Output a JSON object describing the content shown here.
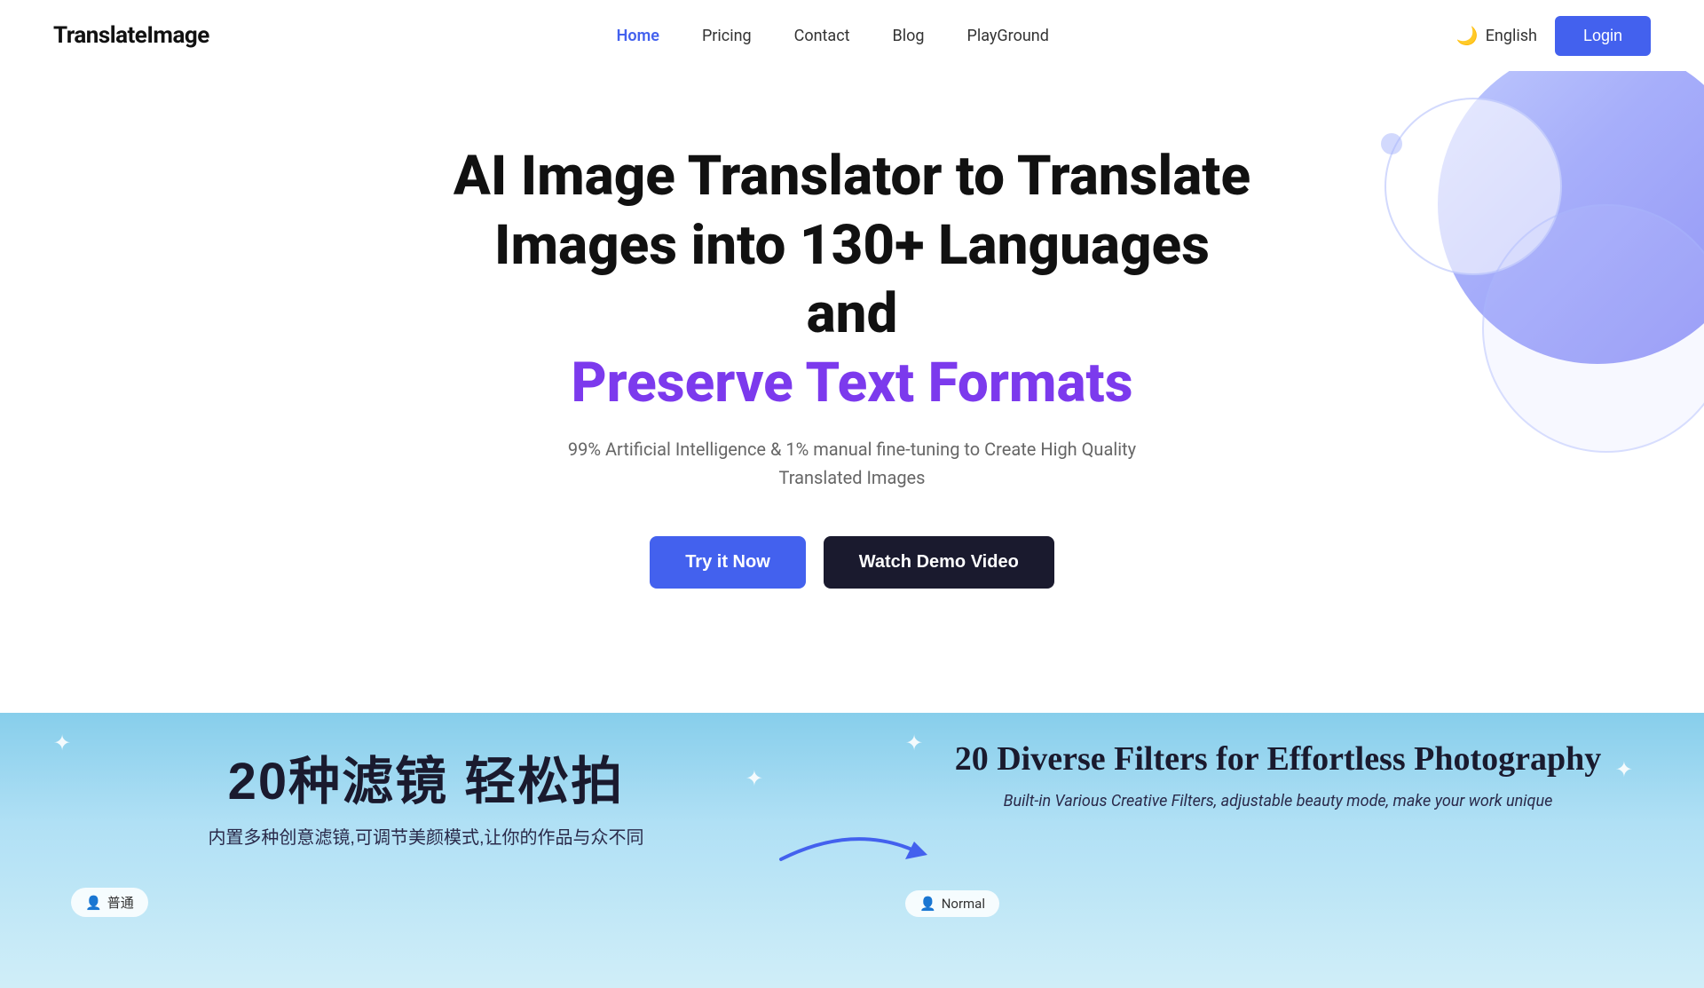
{
  "brand": {
    "name": "TranslateImage"
  },
  "navbar": {
    "links": [
      {
        "label": "Home",
        "active": true,
        "id": "home"
      },
      {
        "label": "Pricing",
        "active": false,
        "id": "pricing"
      },
      {
        "label": "Contact",
        "active": false,
        "id": "contact"
      },
      {
        "label": "Blog",
        "active": false,
        "id": "blog"
      },
      {
        "label": "PlayGround",
        "active": false,
        "id": "playground"
      }
    ],
    "language": "English",
    "login_label": "Login"
  },
  "hero": {
    "title_line1": "AI Image Translator to Translate",
    "title_line2": "Images into 130+ Languages and",
    "title_highlight": "Preserve Text Formats",
    "subtitle": "99% Artificial Intelligence & 1% manual fine-tuning to Create High Quality Translated Images",
    "btn_primary": "Try it Now",
    "btn_secondary": "Watch Demo Video"
  },
  "demo": {
    "before": {
      "main_text": "20种滤镜 轻松拍",
      "sub_text": "内置多种创意滤镜,可调节美颜模式,让你的作品与众不同",
      "badge": "普通"
    },
    "after": {
      "main_text": "20 Diverse Filters for Effortless Photography",
      "sub_text": "Built-in Various Creative Filters, adjustable beauty mode, make your work unique",
      "badge": "Normal"
    }
  },
  "colors": {
    "primary": "#4361ee",
    "purple": "#7c3aed",
    "dark": "#1a1a2e",
    "text_gray": "#666",
    "decoration_blue": "#818cf8"
  }
}
